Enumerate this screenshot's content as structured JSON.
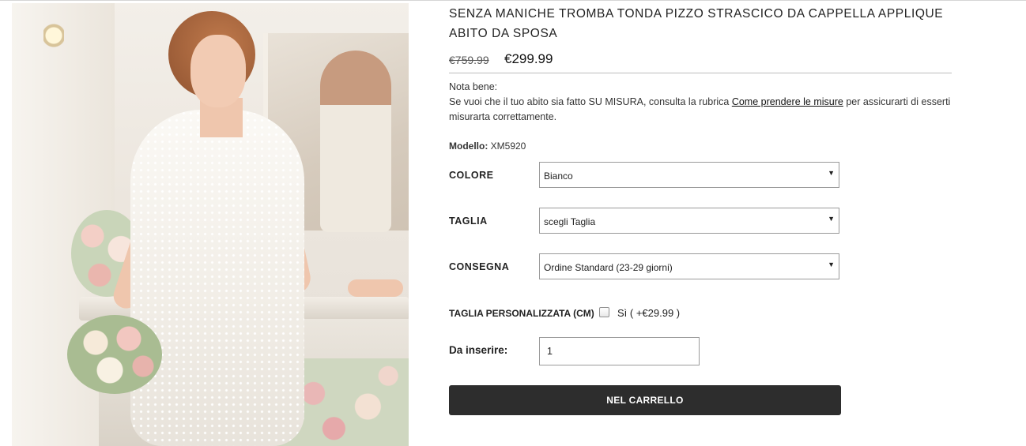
{
  "product": {
    "title": "SENZA MANICHE TROMBA TONDA PIZZO STRASCICO DA CAPPELLA APPLIQUE ABITO DA SPOSA",
    "old_price": "€759.99",
    "new_price": "€299.99",
    "image_alt": "wedding-dress-photo"
  },
  "note": {
    "heading": "Nota bene:",
    "text_before": "Se vuoi che il tuo abito sia fatto SU MISURA, consulta la rubrica ",
    "link": "Come prendere le misure",
    "text_after": " per assicurarti di esserti misurarta correttamente."
  },
  "model": {
    "label": "Modello:",
    "value": " XM5920"
  },
  "options": {
    "color": {
      "label": "COLORE",
      "value": "Bianco"
    },
    "size": {
      "label": "TAGLIA",
      "value": "scegli Taglia"
    },
    "delivery": {
      "label": "CONSEGNA",
      "value": "Ordine Standard (23-29 giorni)"
    }
  },
  "custom_size": {
    "label": "TAGLIA PERSONALIZZATA (CM)",
    "option": "Sì ( +€29.99 )",
    "checked": false
  },
  "quantity": {
    "label": "Da inserire:",
    "value": "1"
  },
  "cart_button": "NEL CARRELLO",
  "icons": {
    "dropdown": "chevron-down-icon",
    "arrow_glyph": "▼"
  }
}
